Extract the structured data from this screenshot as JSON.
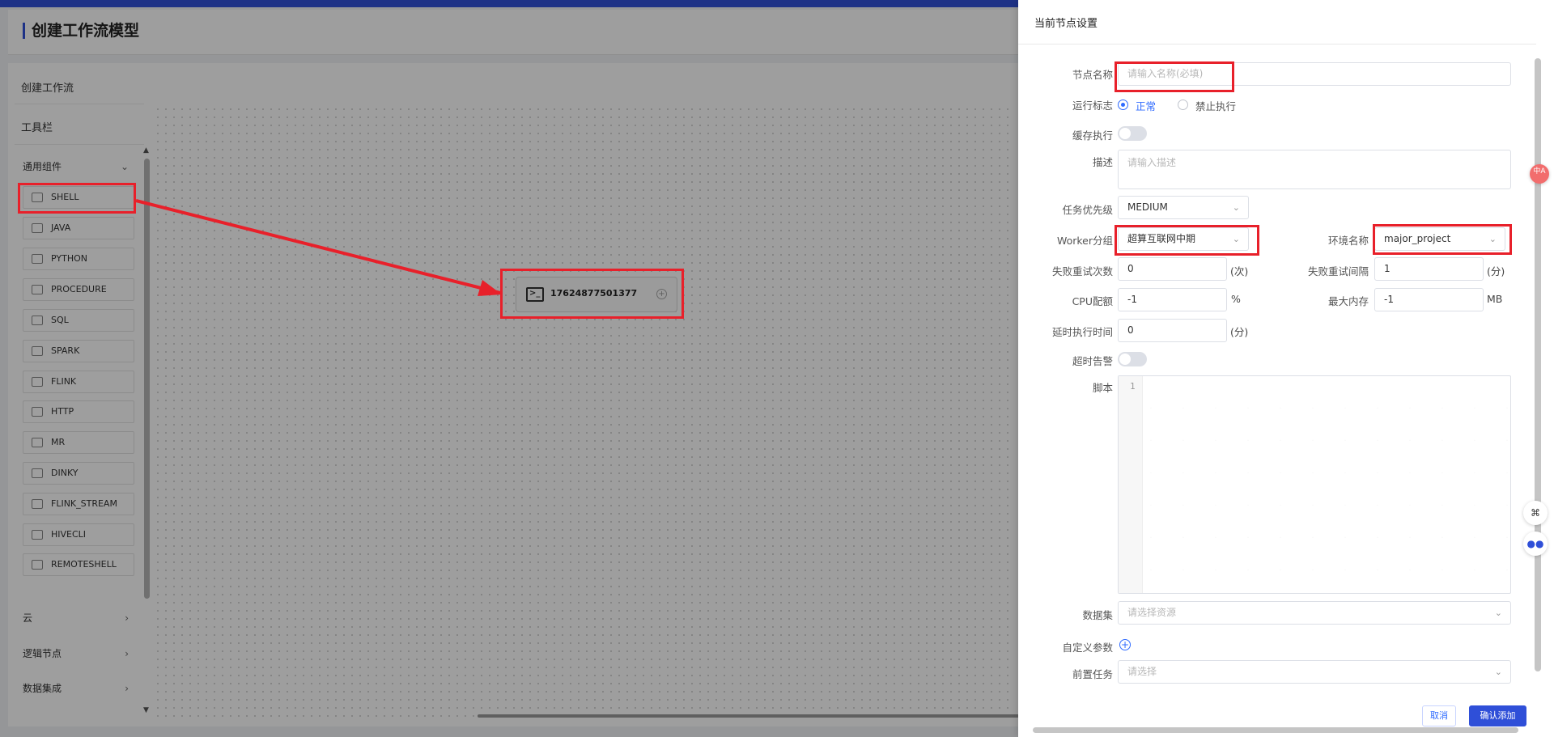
{
  "page": {
    "title": "创建工作流模型"
  },
  "sidebar": {
    "create_workflow": "创建工作流",
    "toolbar": "工具栏",
    "general_group": "通用组件",
    "components": [
      "SHELL",
      "JAVA",
      "PYTHON",
      "PROCEDURE",
      "SQL",
      "SPARK",
      "FLINK",
      "HTTP",
      "MR",
      "DINKY",
      "FLINK_STREAM",
      "HIVECLI",
      "REMOTESHELL"
    ],
    "groups": [
      "云",
      "逻辑节点",
      "数据集成"
    ]
  },
  "canvas": {
    "node_label": "17624877501377"
  },
  "drawer": {
    "title": "当前节点设置",
    "fields": {
      "node_name_label": "节点名称",
      "node_name_placeholder": "请输入名称(必填)",
      "run_flag_label": "运行标志",
      "run_flag_normal": "正常",
      "run_flag_forbid": "禁止执行",
      "cache_label": "缓存执行",
      "desc_label": "描述",
      "desc_placeholder": "请输入描述",
      "priority_label": "任务优先级",
      "priority_value": "MEDIUM",
      "worker_label": "Worker分组",
      "worker_value": "超算互联网中期",
      "env_label": "环境名称",
      "env_value": "major_project",
      "retry_times_label": "失败重试次数",
      "retry_times_value": "0",
      "retry_times_unit": "(次)",
      "retry_interval_label": "失败重试间隔",
      "retry_interval_value": "1",
      "retry_interval_unit": "(分)",
      "cpu_label": "CPU配额",
      "cpu_value": "-1",
      "cpu_unit": "%",
      "mem_label": "最大内存",
      "mem_value": "-1",
      "mem_unit": "MB",
      "delay_label": "延时执行时间",
      "delay_value": "0",
      "delay_unit": "(分)",
      "timeout_label": "超时告警",
      "script_label": "脚本",
      "script_line": "1",
      "dataset_label": "数据集",
      "dataset_placeholder": "请选择资源",
      "custom_params_label": "自定义参数",
      "pre_task_label": "前置任务",
      "pre_task_placeholder": "请选择"
    },
    "buttons": {
      "cancel": "取消",
      "confirm": "确认添加"
    },
    "float": {
      "lang": "中A"
    }
  },
  "colors": {
    "primary": "#2f4fd8",
    "annotation": "#e8202a"
  }
}
